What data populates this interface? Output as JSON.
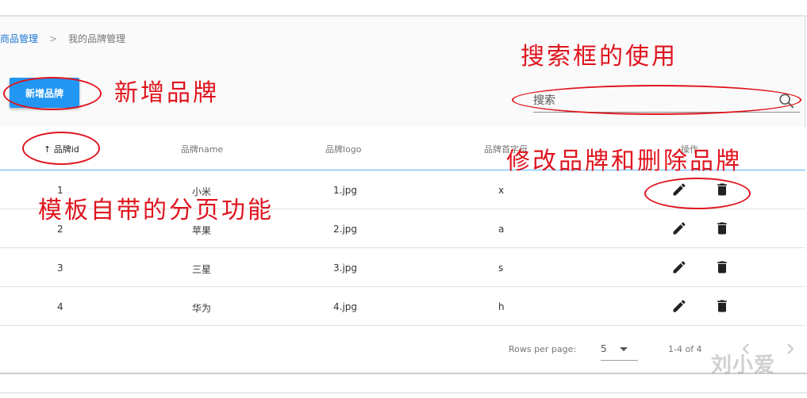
{
  "breadcrumb": {
    "parent": "商品管理",
    "separator": ">",
    "current": "我的品牌管理"
  },
  "toolbar": {
    "add_label": "新增品牌"
  },
  "search": {
    "placeholder": "搜索"
  },
  "table": {
    "columns": [
      {
        "label": "品牌id",
        "sort_indicator": "↑"
      },
      {
        "label": "品牌name"
      },
      {
        "label": "品牌logo"
      },
      {
        "label": "品牌首字母"
      },
      {
        "label": "操作"
      }
    ],
    "rows": [
      {
        "id": "1",
        "name": "小米",
        "logo": "1.jpg",
        "letter": "x"
      },
      {
        "id": "2",
        "name": "苹果",
        "logo": "2.jpg",
        "letter": "a"
      },
      {
        "id": "3",
        "name": "三星",
        "logo": "3.jpg",
        "letter": "s"
      },
      {
        "id": "4",
        "name": "华为",
        "logo": "4.jpg",
        "letter": "h"
      }
    ]
  },
  "pagination": {
    "rows_per_page_label": "Rows per page:",
    "rows_per_page_value": "5",
    "range": "1-4 of 4"
  },
  "annotations": {
    "search_note": "搜索框的使用",
    "add_note": "新增品牌",
    "edit_delete_note": "修改品牌和删除品牌",
    "pagination_note": "模板自带的分页功能",
    "color": "#e0141e"
  },
  "watermark": "刘小爱",
  "colors": {
    "primary": "#2196f3",
    "link": "#1976d2"
  }
}
